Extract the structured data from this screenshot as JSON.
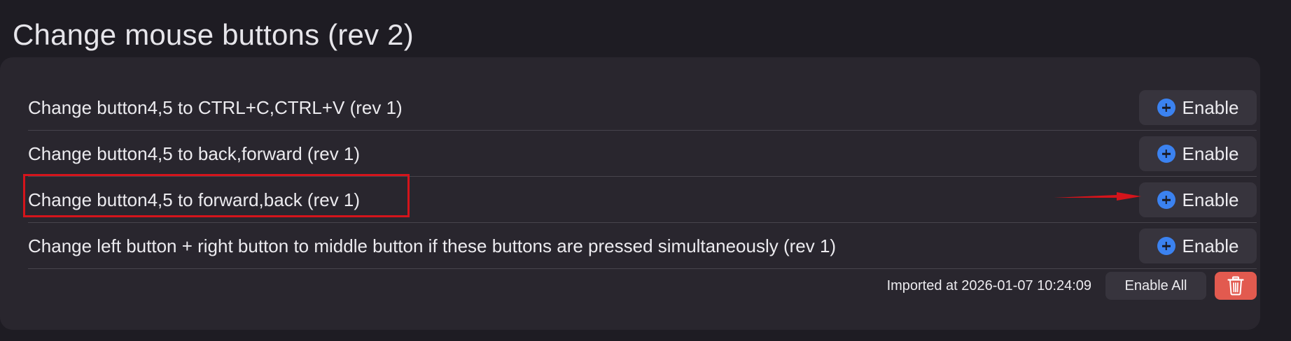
{
  "page": {
    "title": "Change mouse buttons (rev 2)"
  },
  "rules": [
    {
      "label": "Change button4,5 to CTRL+C,CTRL+V (rev 1)",
      "button_label": "Enable",
      "button_icon": "plus-circle-icon"
    },
    {
      "label": "Change button4,5 to back,forward (rev 1)",
      "button_label": "Enable",
      "button_icon": "plus-circle-icon"
    },
    {
      "label": "Change button4,5 to forward,back (rev 1)",
      "button_label": "Enable",
      "button_icon": "plus-circle-icon",
      "highlighted": true
    },
    {
      "label": "Change left button + right button to middle button if these buttons are pressed simultaneously (rev 1)",
      "button_label": "Enable",
      "button_icon": "plus-circle-icon"
    }
  ],
  "footer": {
    "imported_text": "Imported at 2026-01-07 10:24:09",
    "enable_all_label": "Enable All",
    "delete_icon": "trash-icon"
  },
  "annotations": {
    "highlight_color": "#d4141b",
    "arrow_icon": "red-arrow-icon"
  },
  "colors": {
    "background": "#1e1c23",
    "panel": "#29262e",
    "button": "#37343d",
    "accent_blue": "#3b82f0",
    "delete_red": "#e25a4f"
  }
}
